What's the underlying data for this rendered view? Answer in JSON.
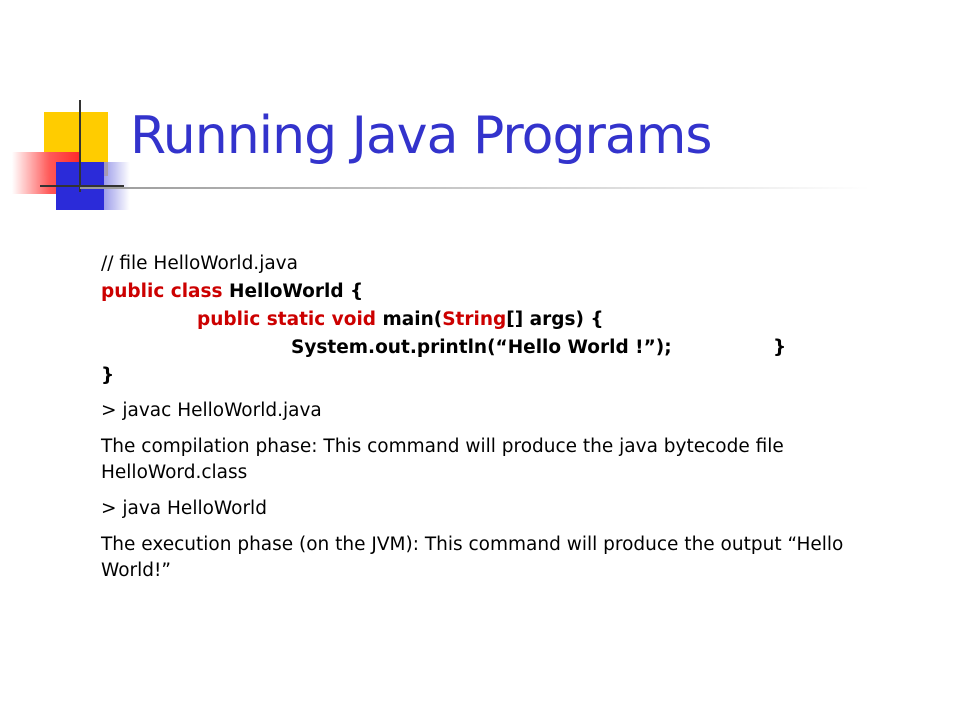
{
  "slide": {
    "title": "Running Java Programs",
    "colors": {
      "title": "#3333cc",
      "keyword": "#cc0000",
      "deco_yellow": "#ffcc00",
      "deco_red": "#ff2a2a",
      "deco_blue": "#2b2bd9"
    },
    "code": {
      "comment": "// file HelloWorld.java",
      "line2_kw": "public class",
      "line2_rest": " HelloWorld {",
      "line3_kw": "public static void",
      "line3_a": " main(",
      "line3_type": "String",
      "line3_b": "[] args) {",
      "line4_code": "System.out.println(“Hello World !”);",
      "line4_close": "}",
      "line5_close": "}"
    },
    "commands": {
      "compile": "> javac HelloWorld.java",
      "compile_desc": "The compilation phase: This command will produce the java bytecode file HelloWord.class",
      "run": "> java HelloWorld",
      "run_desc": "The execution phase (on the JVM): This command will produce the output “Hello World!”"
    }
  }
}
